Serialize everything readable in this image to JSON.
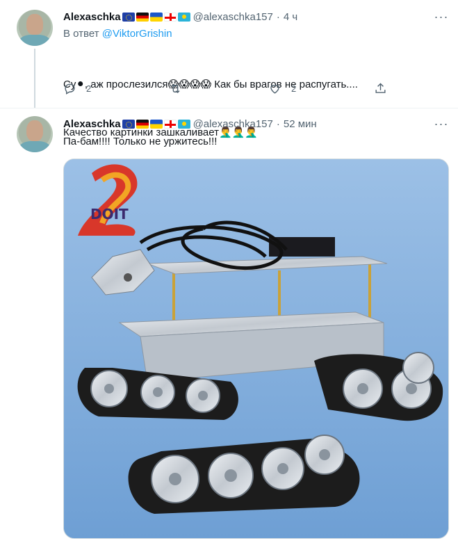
{
  "tweets": [
    {
      "author": "Alexaschka",
      "flags": [
        "eu-flag",
        "germany-flag",
        "ukraine-flag",
        "georgia-flag",
        "kazakhstan-flag"
      ],
      "handle": "@alexaschka157",
      "separator": "·",
      "time": "4 ч",
      "reply_prefix": "В ответ ",
      "reply_to": "@ViktorGrishin",
      "text_line1": "Су⚫, аж прослезился😱😱😱😱 Как бы врагов не распугать....",
      "text_line2": "Качество картинки зашкаливает🤦‍♂️🤦‍♂️🤦‍♂️",
      "actions": {
        "reply_count": "2",
        "retweet_count": "",
        "like_count": "2"
      }
    },
    {
      "author": "Alexaschka",
      "flags": [
        "eu-flag",
        "germany-flag",
        "ukraine-flag",
        "georgia-flag",
        "kazakhstan-flag"
      ],
      "handle": "@alexaschka157",
      "separator": "·",
      "time": "52 мин",
      "text": "Па-бам!!!! Только не уржитесь!!!",
      "image_logo_text": "DOIT"
    }
  ],
  "colors": {
    "accent": "#1d9bf0",
    "secondary_text": "#536471",
    "image_background": "#86aedc"
  }
}
